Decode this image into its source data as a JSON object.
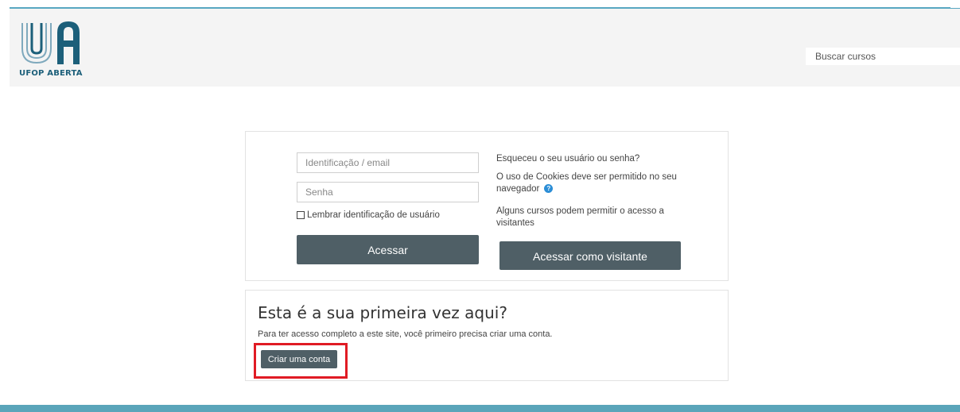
{
  "header": {
    "brand_text": "UFOP ABERTA",
    "search_placeholder": "Buscar cursos",
    "colors": {
      "header_bg": "#f4f4f4",
      "brand": "#1c5f7a",
      "top_border": "#58a7c1"
    }
  },
  "login": {
    "username_placeholder": "Identificação / email",
    "password_placeholder": "Senha",
    "remember_label": "Lembrar identificação de usuário",
    "login_button": "Acessar",
    "forgot_link": "Esqueceu o seu usuário ou senha?",
    "cookies_notice": "O uso de Cookies deve ser permitido no seu navegador",
    "help_icon": "question-circle-icon",
    "guest_notice": "Alguns cursos podem permitir o acesso a visitantes",
    "guest_button": "Acessar como visitante",
    "colors": {
      "button_bg": "#4f5f66",
      "help_icon": "#2c8ed6"
    }
  },
  "signup": {
    "title": "Esta é a sua primeira vez aqui?",
    "description": "Para ter acesso completo a este site, você primeiro precisa criar uma conta.",
    "button": "Criar uma conta",
    "colors": {
      "highlight_border": "#e01b24"
    }
  },
  "footer": {
    "colors": {
      "bar": "#5aa5ba"
    }
  }
}
